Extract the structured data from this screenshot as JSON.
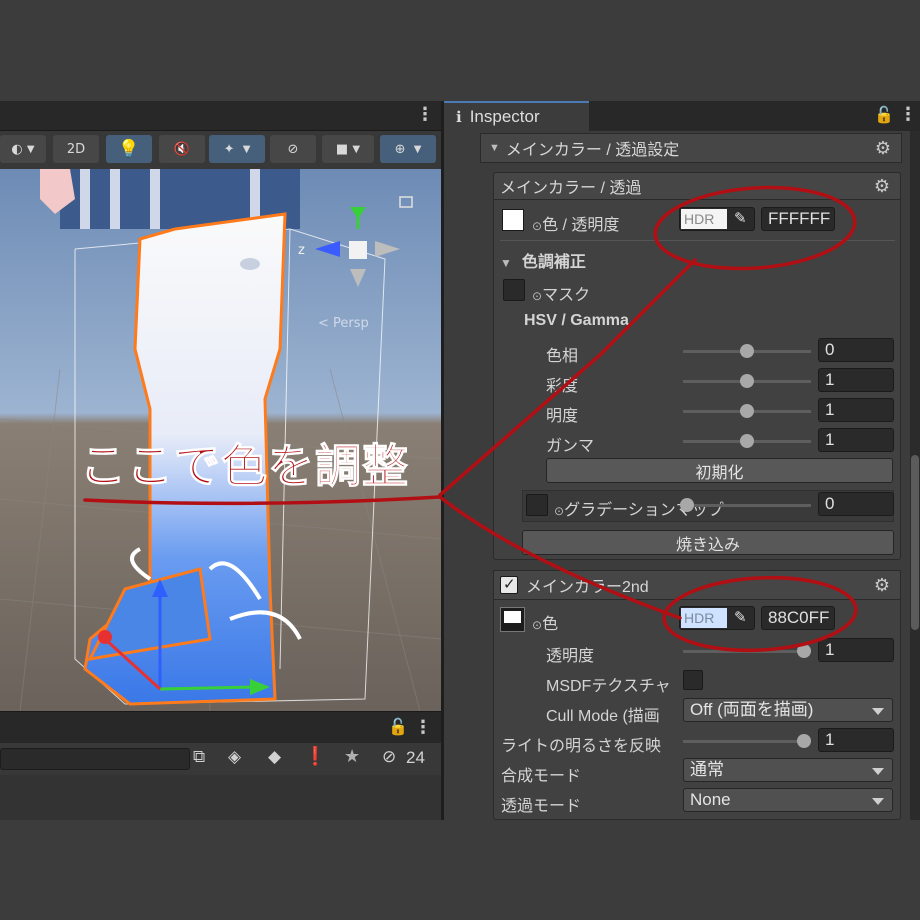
{
  "scene": {
    "toolbar": {
      "mode_2d_label": "2D"
    },
    "gizmo": {
      "axis_label": "z",
      "persp_label": "< Persp"
    }
  },
  "annotation": {
    "text": "ここで色を調整"
  },
  "project_panel": {
    "hidden_count": "24"
  },
  "inspector": {
    "tab_title": "Inspector",
    "section_title": "メインカラー / 透過設定",
    "main_color": {
      "title": "メインカラー / 透過",
      "color_label": "色 / 透明度",
      "hdr_label": "HDR",
      "hex_value": "FFFFFF",
      "swatch_color": "#ffffff"
    },
    "color_correction": {
      "title": "色調補正",
      "mask_label": "マスク",
      "hsv_title": "HSV / Gamma",
      "rows": [
        {
          "label": "色相",
          "value": "0"
        },
        {
          "label": "彩度",
          "value": "1"
        },
        {
          "label": "明度",
          "value": "1"
        },
        {
          "label": "ガンマ",
          "value": "1"
        }
      ],
      "reset_button": "初期化",
      "gradient_label": "グラデーションマップ",
      "gradient_value": "0",
      "bake_button": "焼き込み"
    },
    "main_color_2nd": {
      "title": "メインカラー2nd",
      "enabled": true,
      "color_label": "色",
      "hdr_label": "HDR",
      "hex_value": "88C0FF",
      "swatch_color": "#ffffff",
      "opacity_label": "透明度",
      "opacity_value": "1",
      "msdf_label": "MSDFテクスチャ",
      "cull_label": "Cull Mode (描画",
      "cull_value": "Off (両面を描画)"
    },
    "light_label": "ライトの明るさを反映",
    "light_value": "1",
    "blend_label": "合成モード",
    "blend_value": "通常",
    "alpha_label": "透過モード",
    "alpha_value": "None"
  },
  "colors": {
    "annotation_red": "#b20f14",
    "outline_orange": "#ff7a1a",
    "active_blue": "#46607c"
  }
}
